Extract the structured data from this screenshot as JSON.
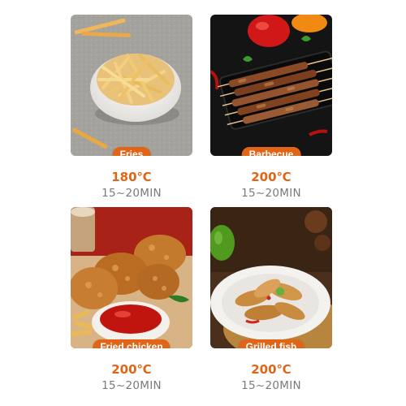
{
  "items": [
    {
      "name": "Fries",
      "temperature": "180℃",
      "time": "15~20MIN",
      "image": "fries-photo"
    },
    {
      "name": "Barbecue",
      "temperature": "200℃",
      "time": "15~20MIN",
      "image": "barbecue-skewers-photo"
    },
    {
      "name": "Fried chicken",
      "temperature": "200℃",
      "time": "15~20MIN",
      "image": "fried-chicken-photo"
    },
    {
      "name": "Grilled fish",
      "temperature": "200℃",
      "time": "15~20MIN",
      "image": "grilled-fish-photo"
    }
  ],
  "colors": {
    "accent": "#e06516",
    "time_text": "#7a7a7a",
    "background": "#ffffff"
  }
}
